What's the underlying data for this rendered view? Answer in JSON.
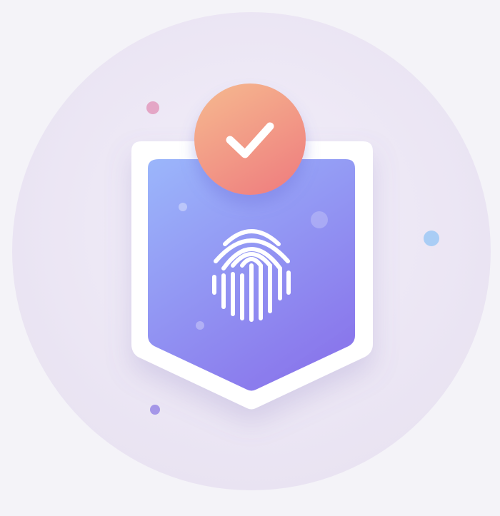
{
  "illustration": {
    "subject": "fingerprint-verified-shield",
    "icons": {
      "shield": "shield-icon",
      "fingerprint": "fingerprint-icon",
      "check": "check-icon"
    },
    "colors": {
      "background": "#f4f3f8",
      "backdrop_circle_light": "#f1edf7",
      "backdrop_circle_dark": "#e7e1f1",
      "shield_outer": "#ffffff",
      "shield_top": "#9bb6fb",
      "shield_bottom": "#8a78ec",
      "badge_top": "#f5b58e",
      "badge_bottom": "#ef7f7f",
      "check_mark": "#ffffff",
      "fingerprint_lines": "#ffffff",
      "dot_pink": "#e4a6c6",
      "dot_blue": "#a9cdf5",
      "dot_purple": "#a596e8"
    }
  }
}
